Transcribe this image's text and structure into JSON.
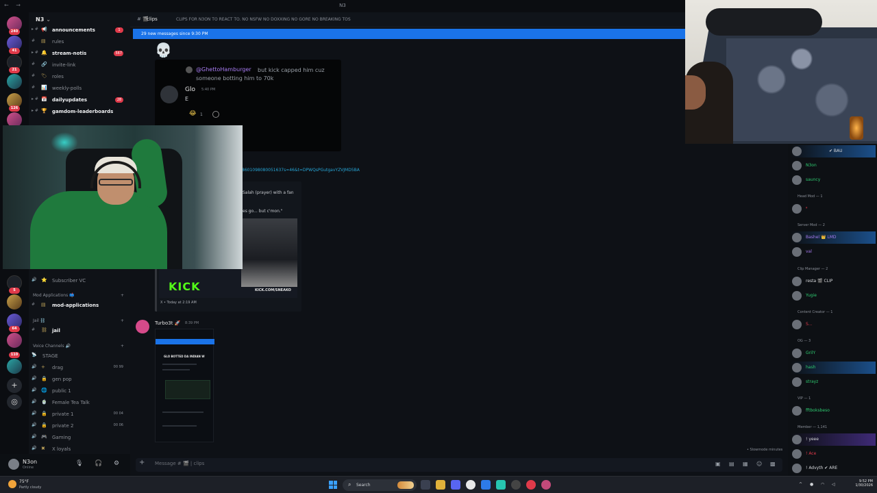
{
  "window": {
    "title": "N3",
    "nav": "←  →"
  },
  "server_rail": {
    "badges": [
      "240",
      "41",
      "21",
      "126",
      "5",
      "64",
      "110"
    ]
  },
  "server": {
    "name": "N3"
  },
  "channels": [
    {
      "label": "announcements",
      "badge": ""
    },
    {
      "label": "rules",
      "badge": ""
    },
    {
      "label": "stream-notis",
      "badge": "567"
    },
    {
      "label": "invite-link",
      "badge": ""
    },
    {
      "label": "roles",
      "badge": ""
    },
    {
      "label": "weekly-polls",
      "badge": ""
    },
    {
      "label": "dailyupdates",
      "badge": "28"
    },
    {
      "label": "gamdom-leaderboards",
      "badge": ""
    }
  ],
  "channels_lower": [
    {
      "label": "Subscriber VC"
    }
  ],
  "categories": {
    "mod_applications": "Mod Applications 📫",
    "jail": "Jail ⛓️",
    "voice": "Voice Channels 🔊"
  },
  "mod_channel": "mod-applications",
  "jail_channel": "jail",
  "voice_channels": [
    {
      "label": "STAGE",
      "counts": ""
    },
    {
      "label": "drag",
      "counts": "00 99"
    },
    {
      "label": "gen pop",
      "counts": ""
    },
    {
      "label": "public 1",
      "counts": ""
    },
    {
      "label": "Female Tea Talk",
      "counts": ""
    },
    {
      "label": "private 1",
      "counts": "00 04"
    },
    {
      "label": "private 2",
      "counts": "00 06"
    },
    {
      "label": "Gaming",
      "counts": ""
    },
    {
      "label": "X loyals",
      "counts": ""
    }
  ],
  "user": {
    "name": "N3on",
    "status": "Online"
  },
  "header": {
    "channel": "clips",
    "topic": "CLIPS FOR N3ON TO REACT TO. NO NSFW NO DOXXING NO GORE NO BREAKING TOS"
  },
  "new_messages": "29 new messages since 9:30 PM",
  "chat": {
    "reply_user": "@GhettoHamburger",
    "reply_text": "but kick capped him cuz someone botting him to 70k",
    "glo_name": "Glo",
    "glo_time": "5:40 PM",
    "glo_msg": "E",
    "reaction_count": "1",
    "link": "8601098080051637s=46&t=DPWQsPGutgavYZVJMD5BA",
    "tweet_text1": "Salah (prayer) with a fan",
    "tweet_text2": "es go... but c'mon.\"",
    "kick_logo": "KICK",
    "kick_url": "KICK.COM/SNEAKO",
    "tweet_footer": "X • Today at 2:19 AM",
    "msg_user": "Turbo3t 🚀",
    "msg_time": "8:39 PM",
    "ss_title": "GLO BOTTED DA INDIAN W"
  },
  "stream_note": "• Slowmode minutes",
  "composer": {
    "placeholder": "Message # 🎬 | clips"
  },
  "members": {
    "categories": {
      "head_mod": "Head Mod — 1",
      "server_mod": "Server Mod — 2",
      "clip_manager": "Clip Manager — 2",
      "content_creator": "Content Creator — 1",
      "og": "OG — 3",
      "vip": "VIP — 1",
      "member": "Member — 1,141"
    },
    "list": [
      {
        "name": "✔ BAU"
      },
      {
        "name": "N3on"
      },
      {
        "name": "sauncy"
      },
      {
        "name": "ᵍ"
      },
      {
        "name": "Bashel 👑 LMD"
      },
      {
        "name": "val"
      },
      {
        "name": "resta 🎬 CLIP"
      },
      {
        "name": "Yugie"
      },
      {
        "name": "S..."
      },
      {
        "name": "GrilY"
      },
      {
        "name": "hash"
      },
      {
        "name": "strayz"
      },
      {
        "name": "fftboksbeso"
      },
      {
        "name": "! yeee"
      },
      {
        "name": "! Ace"
      },
      {
        "name": "! Advyth ✔ ARE"
      }
    ]
  },
  "taskbar": {
    "weather_temp": "75°F",
    "weather_desc": "Partly cloudy",
    "search": "Search",
    "time": "9:52 PM",
    "date": "1/30/2026"
  },
  "colors": {
    "accent": "#1a73e8",
    "kick": "#53fc18",
    "badge": "#e03a4a"
  }
}
